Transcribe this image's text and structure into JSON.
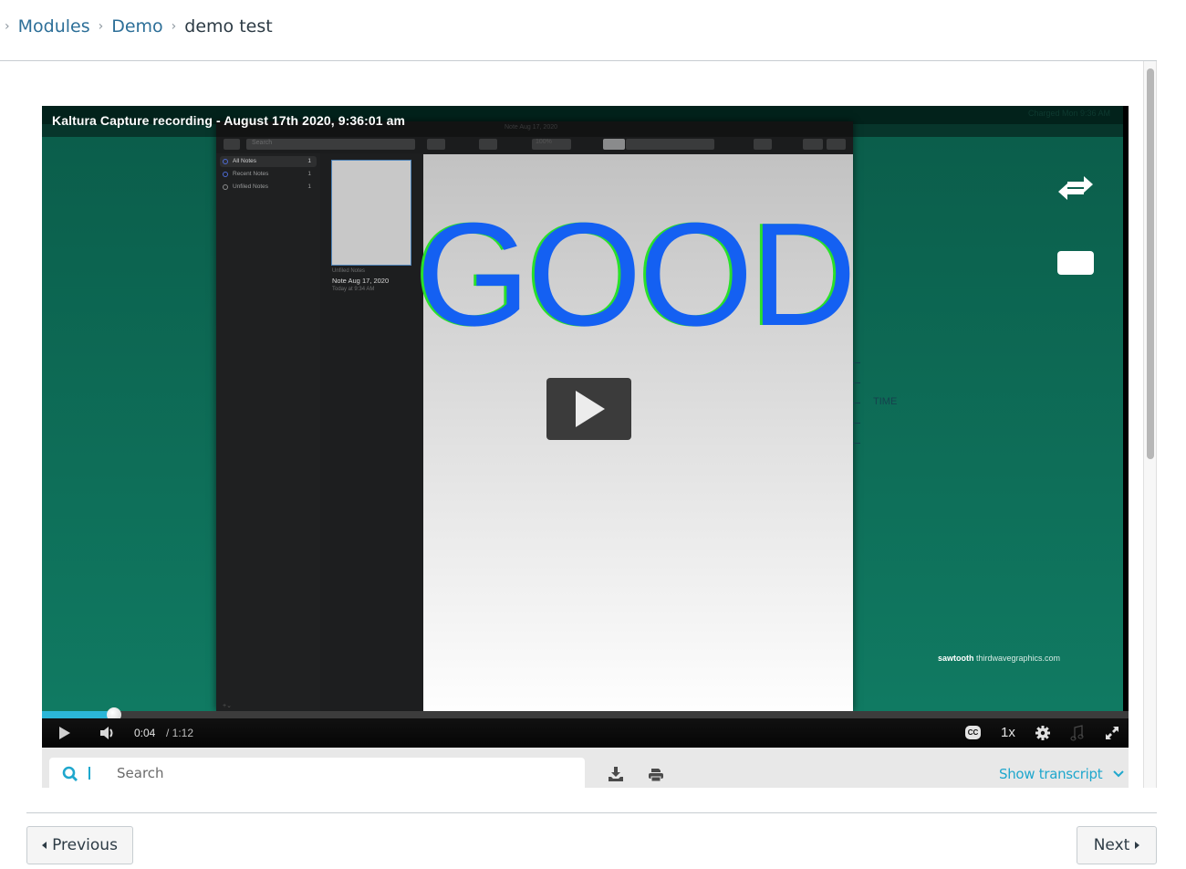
{
  "breadcrumb": {
    "items": [
      {
        "label": "Modules",
        "link": true
      },
      {
        "label": "Demo",
        "link": true
      },
      {
        "label": "demo test",
        "link": false
      }
    ]
  },
  "player": {
    "title": "Kaltura Capture recording - August 17th 2020, 9:36:01 am",
    "menubar_status": "Charged  Mon 9:36 AM",
    "notes_app": {
      "window_title": "Note Aug 17, 2020",
      "search_placeholder": "Search",
      "zoom_value": "100%",
      "sidebar": [
        {
          "label": "All Notes",
          "count": "1",
          "active": true
        },
        {
          "label": "Recent Notes",
          "count": "1",
          "active": false
        },
        {
          "label": "Unfiled Notes",
          "count": "1",
          "active": false
        }
      ],
      "note": {
        "folder": "Unfiled Notes",
        "name": "Note Aug 17, 2020",
        "time": "Today at 9:34 AM"
      },
      "sidebar_footer": "+⌄",
      "editor_text": "GOOD"
    },
    "slide": {
      "axis_label": "TIME",
      "brand_bold": "sawtooth",
      "brand_rest": "thirdwavegraphics.com"
    },
    "icons": {
      "swap": "swap-arrows-icon",
      "pip": "picture-in-picture-icon",
      "big_play": "play-icon"
    },
    "controls": {
      "current_time": "0:04",
      "duration": "/ 1:12",
      "progress_fraction": 0.066,
      "speed": "1x",
      "cc": "CC",
      "accent": "#2bb6d7"
    }
  },
  "transcript": {
    "search_placeholder": "Search",
    "show_label": "Show transcript",
    "accent": "#1fa7cd"
  },
  "footer": {
    "previous_label": "Previous",
    "next_label": "Next"
  }
}
